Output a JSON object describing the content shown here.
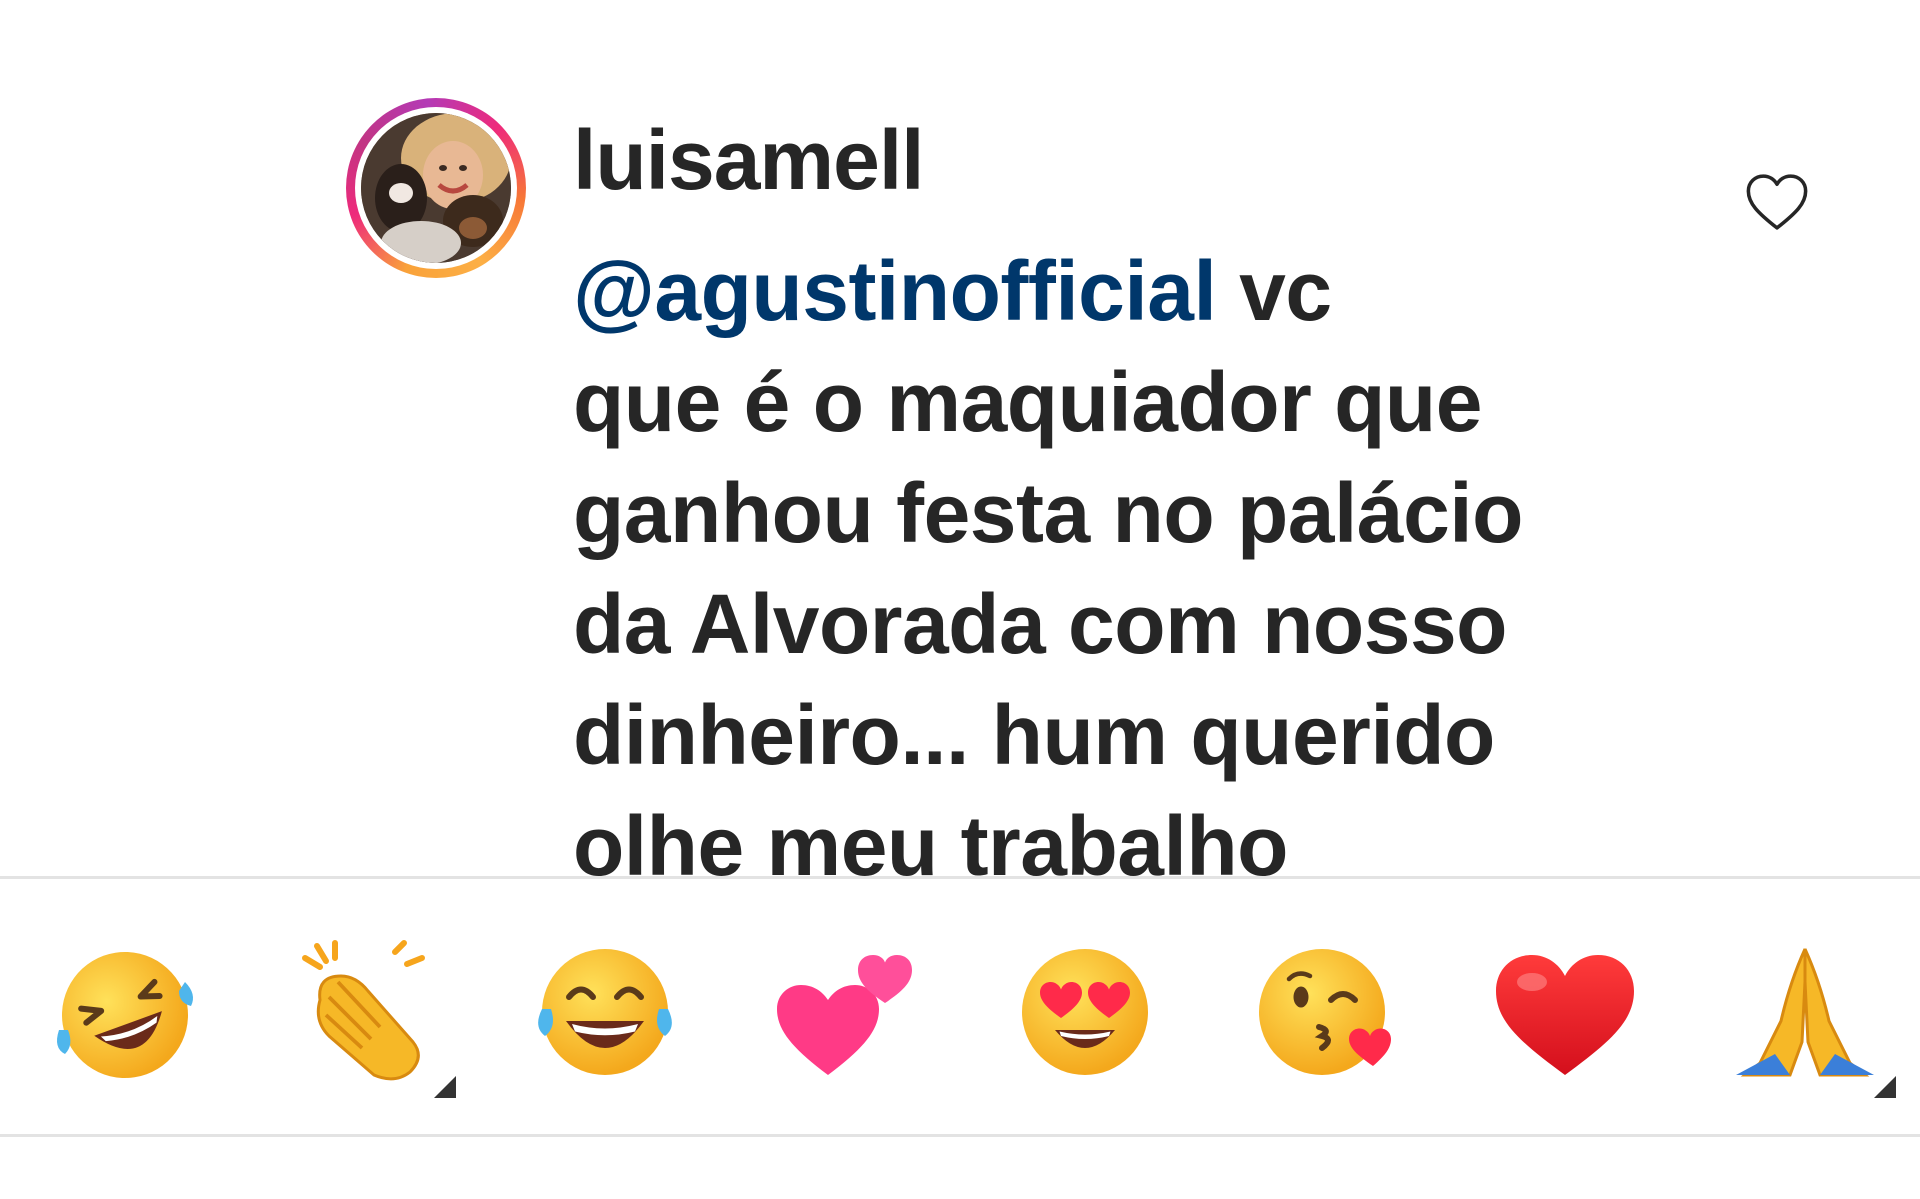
{
  "comment": {
    "username": "luisamell",
    "mention": "@agustinofficial",
    "text_lines": [
      " vc",
      "que é o maquiador que",
      "ganhou festa no palácio",
      "da Alvorada com nosso",
      "dinheiro... hum querido",
      "olhe meu trabalho"
    ],
    "like_icon": "heart-outline-icon"
  },
  "emoji_bar": {
    "items": [
      {
        "name": "rolling-on-floor-laughing",
        "char": "🤣"
      },
      {
        "name": "clapping-hands",
        "char": "👏"
      },
      {
        "name": "face-with-tears-of-joy",
        "char": "😂"
      },
      {
        "name": "two-hearts",
        "char": "💕"
      },
      {
        "name": "heart-eyes",
        "char": "😍"
      },
      {
        "name": "face-blowing-a-kiss",
        "char": "😘"
      },
      {
        "name": "red-heart",
        "char": "❤️"
      },
      {
        "name": "folded-hands",
        "char": "🙏"
      }
    ]
  },
  "colors": {
    "text": "#262626",
    "mention": "#00376b",
    "divider": "#e3e3e3"
  }
}
